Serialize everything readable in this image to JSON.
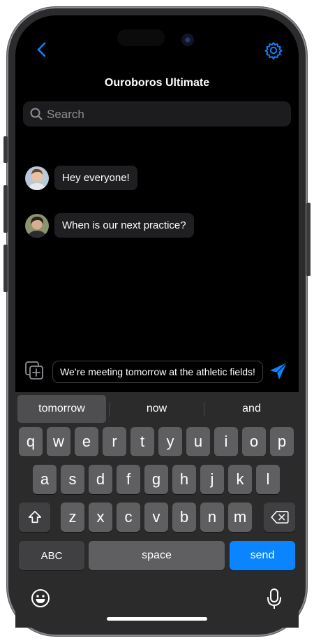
{
  "header": {
    "title": "Ouroboros Ultimate"
  },
  "search": {
    "placeholder": "Search"
  },
  "messages": [
    {
      "text": "Hey everyone!"
    },
    {
      "text": "When is our next practice?"
    }
  ],
  "composer": {
    "text": "We’re meeting tomorrow at the athletic fields!"
  },
  "keyboard": {
    "suggestions": [
      "tomorrow",
      "now",
      "and"
    ],
    "row1": [
      "q",
      "w",
      "e",
      "r",
      "t",
      "y",
      "u",
      "i",
      "o",
      "p"
    ],
    "row2": [
      "a",
      "s",
      "d",
      "f",
      "g",
      "h",
      "j",
      "k",
      "l"
    ],
    "row3": [
      "z",
      "x",
      "c",
      "v",
      "b",
      "n",
      "m"
    ],
    "abc_label": "ABC",
    "space_label": "space",
    "send_label": "send"
  },
  "colors": {
    "accent": "#0a84ff",
    "background": "#000000",
    "bubble": "#1f1f21"
  }
}
